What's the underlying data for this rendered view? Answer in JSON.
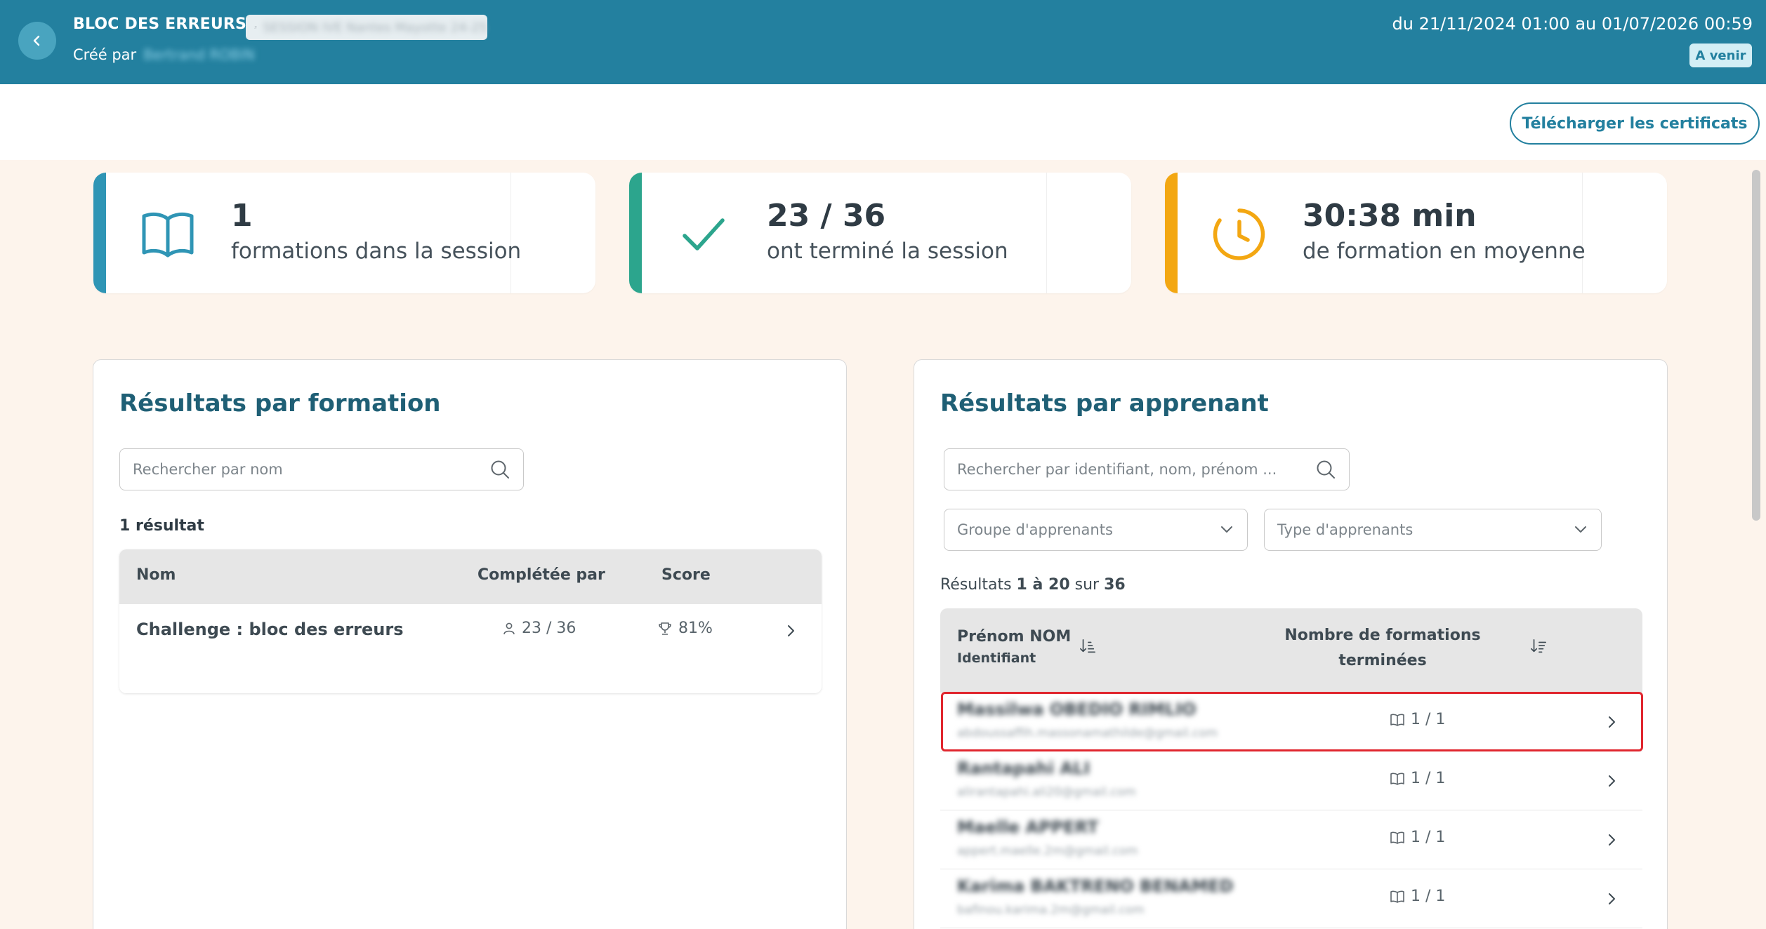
{
  "header": {
    "title": "BLOC DES ERREURS",
    "group_chip": "SESSION IVE Nantes Mayotte 24-25",
    "created_by_label": "Créé par",
    "created_by_name": "Bertrand ROBIN",
    "date_range": "du 21/11/2024 01:00 au 01/07/2026 00:59",
    "status": "A venir",
    "back_icon": "chevron-left-icon"
  },
  "toolbar": {
    "download_label": "Télécharger les certificats"
  },
  "stats": [
    {
      "value": "1",
      "label": "formations dans la session",
      "icon": "book-icon",
      "accent": "#2f95b5"
    },
    {
      "value": "23 / 36",
      "label": "ont terminé la session",
      "icon": "check-icon",
      "accent": "#2ca58d"
    },
    {
      "value": "30:38 min",
      "label": "de formation en moyenne",
      "icon": "clock-icon",
      "accent": "#f3a712"
    }
  ],
  "formation_panel": {
    "title": "Résultats par formation",
    "search_placeholder": "Rechercher par nom",
    "result_count": "1 résultat",
    "columns": {
      "name": "Nom",
      "completed_by": "Complétée par",
      "score": "Score"
    },
    "rows": [
      {
        "name": "Challenge : bloc des erreurs",
        "completed_by": "23 / 36",
        "score": "81%"
      }
    ]
  },
  "learner_panel": {
    "title": "Résultats par apprenant",
    "search_placeholder": "Rechercher par identifiant, nom, prénom ...",
    "group_select_placeholder": "Groupe d'apprenants",
    "type_select_placeholder": "Type d'apprenants",
    "results_prefix": "Résultats",
    "results_range": "1 à 20",
    "results_mid": "sur",
    "results_total": "36",
    "columns": {
      "name": "Prénom NOM",
      "identifier": "Identifiant",
      "completed_line1": "Nombre de formations",
      "completed_line2": "terminées"
    },
    "rows": [
      {
        "name": "Massilwa OBEDIO RIMLIO",
        "email": "abdoussaffih.massonamathilde@gmail.com",
        "completed": "1 / 1"
      },
      {
        "name": "Rantapahi ALI",
        "email": "alirantapahi.ali20@gmail.com",
        "completed": "1 / 1"
      },
      {
        "name": "Maelle APPERT",
        "email": "appert.maelle.2m@gmail.com",
        "completed": "1 / 1"
      },
      {
        "name": "Karima BAKTRENO BENAMED",
        "email": "bafinou.karima.2m@gmail.com",
        "completed": "1 / 1"
      }
    ]
  },
  "colors": {
    "header_bg": "#23809f",
    "page_bg": "#fdf4ec",
    "title": "#1f5f75",
    "highlight": "#e0262e"
  }
}
